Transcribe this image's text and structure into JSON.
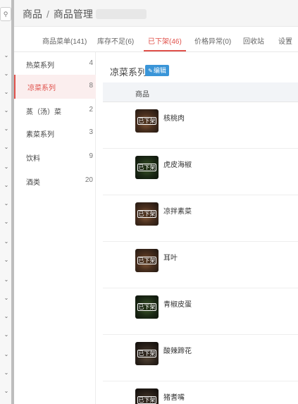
{
  "breadcrumb": {
    "root": "商品",
    "separator": "/",
    "current": "商品管理"
  },
  "tabs": [
    {
      "label": "商品菜单(141)",
      "active": false
    },
    {
      "label": "库存不足(6)",
      "active": false
    },
    {
      "label": "已下架(46)",
      "active": true
    },
    {
      "label": "价格异常(0)",
      "active": false
    },
    {
      "label": "回收站",
      "active": false
    },
    {
      "label": "设置",
      "active": false
    }
  ],
  "categories": [
    {
      "name": "热菜系列",
      "count": "4",
      "active": false
    },
    {
      "name": "凉菜系列",
      "count": "8",
      "active": true
    },
    {
      "name": "蒸（汤）菜",
      "count": "2",
      "active": false
    },
    {
      "name": "素菜系列",
      "count": "3",
      "active": false
    },
    {
      "name": "饮料",
      "count": "9",
      "active": false
    },
    {
      "name": "酒类",
      "count": "20",
      "active": false
    }
  ],
  "section": {
    "title": "凉菜系列",
    "edit_label": "编辑",
    "edit_icon": "pencil-icon"
  },
  "table": {
    "column_header": "商品",
    "rows": [
      {
        "name": "核桃肉",
        "badge": "已下架"
      },
      {
        "name": "虎皮海椒",
        "badge": "已下架"
      },
      {
        "name": "凉拌素菜",
        "badge": "已下架"
      },
      {
        "name": "耳叶",
        "badge": "已下架"
      },
      {
        "name": "青椒皮蛋",
        "badge": "已下架"
      },
      {
        "name": "酸辣蹄花",
        "badge": "已下架"
      },
      {
        "name": "猪耆嘴",
        "badge": "已下架"
      }
    ]
  },
  "colors": {
    "accent": "#e0504a",
    "edit_button": "#3a95d8",
    "table_header_bg": "#f2f4f7"
  },
  "icons": {
    "rail_search": "search-icon",
    "rail_expand": "chevron-down-icon"
  }
}
